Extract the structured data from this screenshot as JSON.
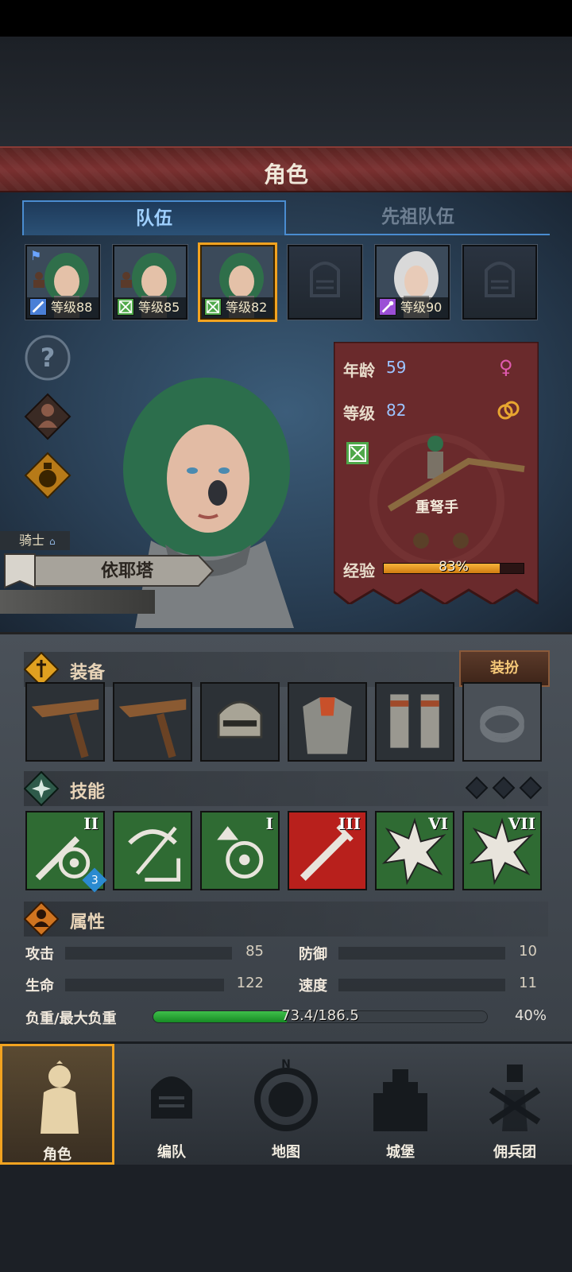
{
  "header": {
    "title": "角色"
  },
  "tabs": [
    {
      "label": "队伍"
    },
    {
      "label": "先祖队伍"
    }
  ],
  "roster": [
    {
      "level_text": "等级88",
      "class_color": "#4a7fd6",
      "flag": "⚑"
    },
    {
      "level_text": "等级85",
      "class_color": "#4fa84a"
    },
    {
      "level_text": "等级82",
      "class_color": "#4fa84a",
      "selected": true
    },
    {
      "level_text": ""
    },
    {
      "level_text": "等级90",
      "class_color": "#9b4fd6"
    },
    {
      "level_text": ""
    }
  ],
  "side_buttons": [
    {
      "icon": "question-icon"
    },
    {
      "icon": "hooded-figure-icon"
    },
    {
      "icon": "potion-icon"
    }
  ],
  "character": {
    "rank": "骑士",
    "name": "依耶塔",
    "age_label": "年龄",
    "age": "59",
    "level_label": "等级",
    "level": "82",
    "class_name": "重弩手",
    "exp_label": "经验",
    "exp_percent": "83%",
    "exp_value": 0.83
  },
  "equipment": {
    "title": "装备",
    "dress_button": "装扮",
    "items": [
      {
        "icon": "crossbow-icon"
      },
      {
        "icon": "crossbow-icon"
      },
      {
        "icon": "helmet-icon"
      },
      {
        "icon": "chainmail-armor-icon"
      },
      {
        "icon": "chainmail-boots-icon"
      },
      {
        "icon": "ring-icon",
        "empty": true
      }
    ]
  },
  "skills": {
    "title": "技能",
    "items": [
      {
        "icon": "sword-target-icon",
        "rank": "II",
        "badge": "3"
      },
      {
        "icon": "crossbow-shot-icon",
        "rank": ""
      },
      {
        "icon": "arrow-target-icon",
        "rank": "I"
      },
      {
        "icon": "sword-strike-icon",
        "rank": "III",
        "red": true
      },
      {
        "icon": "burst-icon",
        "rank": "VI"
      },
      {
        "icon": "burst-icon",
        "rank": "VII"
      }
    ]
  },
  "attributes": {
    "title": "属性",
    "attack_label": "攻击",
    "attack": "85",
    "defense_label": "防御",
    "defense": "10",
    "hp_label": "生命",
    "hp": "122",
    "speed_label": "速度",
    "speed": "11",
    "load_label": "负重/最大负重",
    "load": "73.4/186.5",
    "load_percent": "40%",
    "load_value": 0.4
  },
  "nav": [
    {
      "label": "角色",
      "icon": "knight-icon",
      "active": true
    },
    {
      "label": "编队",
      "icon": "helmet-icon"
    },
    {
      "label": "地图",
      "icon": "compass-icon"
    },
    {
      "label": "城堡",
      "icon": "castle-icon"
    },
    {
      "label": "佣兵团",
      "icon": "mercenary-icon"
    }
  ]
}
